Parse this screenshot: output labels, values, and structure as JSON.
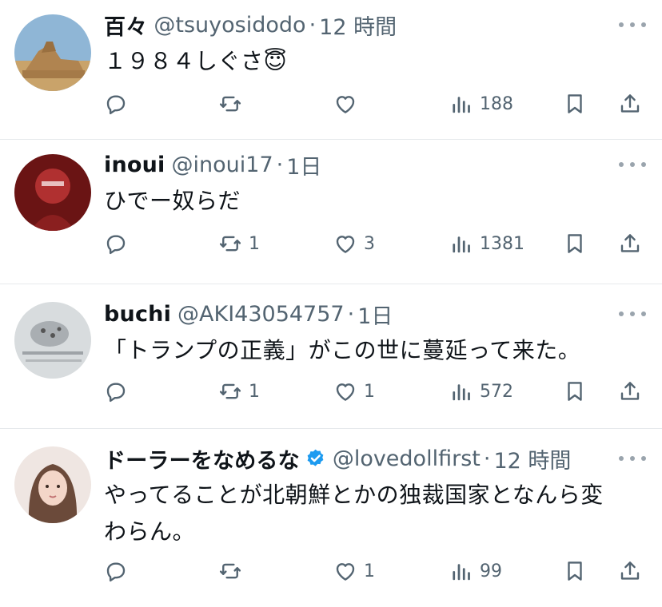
{
  "tweets": [
    {
      "name": "百々",
      "handle": "@tsuyosidodo",
      "dot": "·",
      "time": "12 時間",
      "text": "１９８４しぐさ😇",
      "text_extra": "",
      "verified": false,
      "replies": "",
      "retweets": "",
      "likes": "",
      "views": "188"
    },
    {
      "name": "inoui",
      "handle": "@inoui17",
      "dot": "·",
      "time": "1日",
      "text": "ひでー奴らだ",
      "text_extra": "",
      "verified": false,
      "replies": "",
      "retweets": "1",
      "likes": "3",
      "views": "1381"
    },
    {
      "name": "buchi",
      "handle": "@AKI43054757",
      "dot": "·",
      "time": "1日",
      "text": "「トランプの正義」がこの世に蔓延って来た。",
      "text_extra": "",
      "verified": false,
      "replies": "",
      "retweets": "1",
      "likes": "1",
      "views": "572"
    },
    {
      "name": "ドーラーをなめるな",
      "handle": "@lovedollfirst",
      "dot": "·",
      "time": "12 時間",
      "text": "やってることが北朝鮮とかの独裁国家となんら変",
      "text_extra": "わらん。",
      "verified": true,
      "replies": "",
      "retweets": "",
      "likes": "1",
      "views": "99"
    }
  ],
  "colors": {
    "text": "#0f1419",
    "muted": "#536471",
    "icon": "#536471",
    "verified": "#1d9bf0",
    "divider": "#e6e9ec"
  },
  "icons": {
    "reply": "speech-bubble-icon",
    "retweet": "retweet-arrows-icon",
    "like": "heart-icon",
    "views": "bar-chart-icon",
    "bookmark": "bookmark-icon",
    "share": "share-upload-icon",
    "more": "more-dots-icon",
    "verified": "verified-badge-icon"
  }
}
